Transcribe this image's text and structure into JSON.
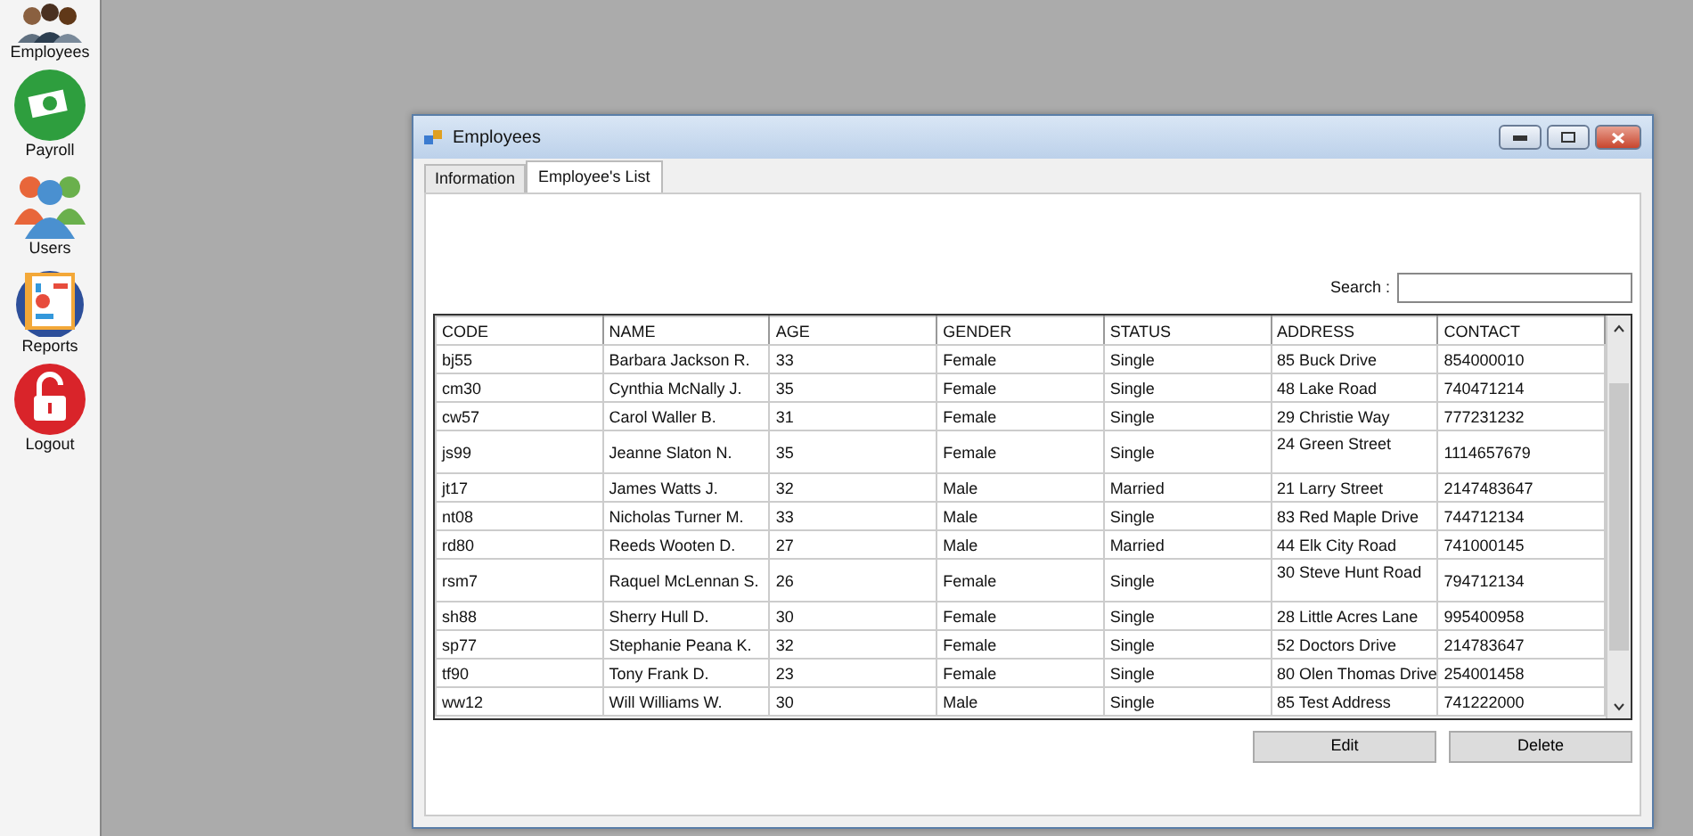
{
  "sidebar": {
    "items": [
      {
        "label": "Employees",
        "kind": "people"
      },
      {
        "label": "Payroll",
        "kind": "money"
      },
      {
        "label": "Users",
        "kind": "users"
      },
      {
        "label": "Reports",
        "kind": "reports"
      },
      {
        "label": "Logout",
        "kind": "lock"
      }
    ]
  },
  "window": {
    "title": "Employees"
  },
  "tabs": [
    {
      "label": "Information",
      "selected": false
    },
    {
      "label": "Employee's List",
      "selected": true
    }
  ],
  "search": {
    "label": "Search :"
  },
  "table": {
    "columns": [
      "CODE",
      "NAME",
      "AGE",
      "GENDER",
      "STATUS",
      "ADDRESS",
      "CONTACT"
    ],
    "rows": [
      {
        "kind": "normal",
        "cells": [
          "bj55",
          "Barbara Jackson R.",
          "33",
          "Female",
          "Single",
          "85 Buck Drive",
          "854000010"
        ]
      },
      {
        "kind": "normal",
        "cells": [
          "cm30",
          "Cynthia McNally J.",
          "35",
          "Female",
          "Single",
          "48 Lake Road",
          "740471214"
        ]
      },
      {
        "kind": "normal",
        "cells": [
          "cw57",
          "Carol Waller B.",
          "31",
          "Female",
          "Single",
          "29 Christie Way",
          "777231232"
        ]
      },
      {
        "kind": "tall",
        "cells": [
          "js99",
          "Jeanne Slaton N.",
          "35",
          "Female",
          "Single",
          "24 Green Street",
          "1114657679"
        ]
      },
      {
        "kind": "normal",
        "cells": [
          "jt17",
          "James Watts J.",
          "32",
          "Male",
          "Married",
          "21 Larry Street",
          "2147483647"
        ]
      },
      {
        "kind": "normal",
        "cells": [
          "nt08",
          "Nicholas Turner M.",
          "33",
          "Male",
          "Single",
          "83 Red Maple Drive",
          "744712134"
        ]
      },
      {
        "kind": "normal",
        "cells": [
          "rd80",
          "Reeds Wooten D.",
          "27",
          "Male",
          "Married",
          "44 Elk City Road",
          "741000145"
        ]
      },
      {
        "kind": "tall",
        "cells": [
          "rsm7",
          "Raquel McLennan S.",
          "26",
          "Female",
          "Single",
          "30 Steve Hunt Road",
          "794712134"
        ]
      },
      {
        "kind": "normal",
        "cells": [
          "sh88",
          "Sherry Hull D.",
          "30",
          "Female",
          "Single",
          "28 Little Acres Lane",
          "995400958"
        ]
      },
      {
        "kind": "normal",
        "cells": [
          "sp77",
          "Stephanie Peana K.",
          "32",
          "Female",
          "Single",
          "52 Doctors Drive",
          "214783647"
        ]
      },
      {
        "kind": "normal",
        "cells": [
          "tf90",
          "Tony Frank D.",
          "23",
          "Female",
          "Single",
          "80 Olen Thomas Drive",
          "254001458"
        ]
      },
      {
        "kind": "normal",
        "cells": [
          "ww12",
          "Will Williams W.",
          "30",
          "Male",
          "Single",
          "85 Test Address",
          "741222000"
        ]
      }
    ]
  },
  "buttons": [
    "Edit",
    "Delete"
  ]
}
